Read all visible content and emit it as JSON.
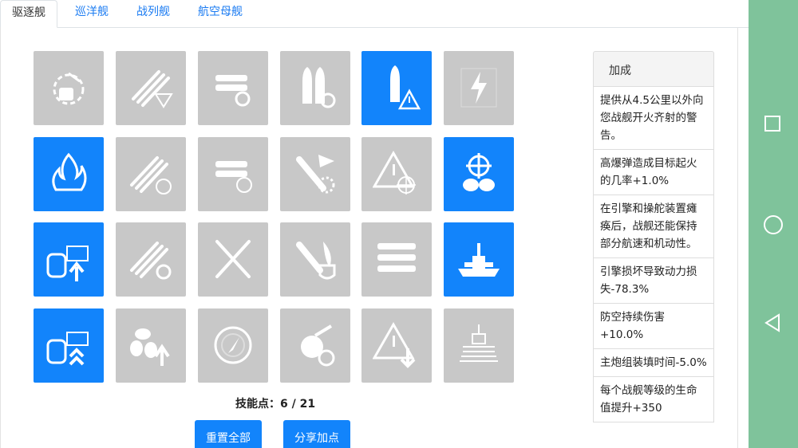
{
  "tabs": [
    {
      "label": "驱逐舰",
      "active": true
    },
    {
      "label": "巡洋舰",
      "active": false
    },
    {
      "label": "战列舰",
      "active": false
    },
    {
      "label": "航空母舰",
      "active": false
    }
  ],
  "skills": [
    {
      "icon": "gun-turret-range-icon",
      "active": false
    },
    {
      "icon": "torpedo-aim-icon",
      "active": false
    },
    {
      "icon": "torpedo-reload-icon",
      "active": false
    },
    {
      "icon": "shell-reload-icon",
      "active": false
    },
    {
      "icon": "shell-warning-icon",
      "active": true
    },
    {
      "icon": "lightning-icon",
      "active": false
    },
    {
      "icon": "fire-icon",
      "active": true
    },
    {
      "icon": "torpedo-speed-icon",
      "active": false
    },
    {
      "icon": "torpedo-tube-timer-icon",
      "active": false
    },
    {
      "icon": "flag-explosion-icon",
      "active": false
    },
    {
      "icon": "warning-target-icon",
      "active": false
    },
    {
      "icon": "helm-propeller-icon",
      "active": true
    },
    {
      "icon": "engine-boost-icon",
      "active": true
    },
    {
      "icon": "torpedo-rearm-icon",
      "active": false
    },
    {
      "icon": "crossed-swords-icon",
      "active": false
    },
    {
      "icon": "fire-shield-icon",
      "active": false
    },
    {
      "icon": "torpedo-rack-icon",
      "active": false
    },
    {
      "icon": "battleship-icon",
      "active": true
    },
    {
      "icon": "engine-double-boost-icon",
      "active": true
    },
    {
      "icon": "propeller-up-icon",
      "active": false
    },
    {
      "icon": "radar-icon",
      "active": false
    },
    {
      "icon": "turret-timer-icon",
      "active": false
    },
    {
      "icon": "warning-down-icon",
      "active": false
    },
    {
      "icon": "ship-silhouette-icon",
      "active": false
    }
  ],
  "points": {
    "label": "技能点：",
    "value": "6 / 21"
  },
  "buttons": {
    "reset": "重置全部",
    "share": "分享加点"
  },
  "bonus": {
    "title": "加成",
    "items": [
      "提供从4.5公里以外向您战舰开火齐射的警告。",
      "高爆弹造成目标起火的几率+1.0%",
      "在引擎和操舵装置瘫痪后，战舰还能保持部分航速和机动性。",
      "引擎损坏导致动力损失-78.3%",
      "防空持续伤害+10.0%",
      "主炮组装填时间-5.0%",
      "每个战舰等级的生命值提升+350"
    ]
  },
  "colors": {
    "active": "#1284fb",
    "inactive": "#c8c8c8",
    "navbar": "#7fc39b"
  }
}
